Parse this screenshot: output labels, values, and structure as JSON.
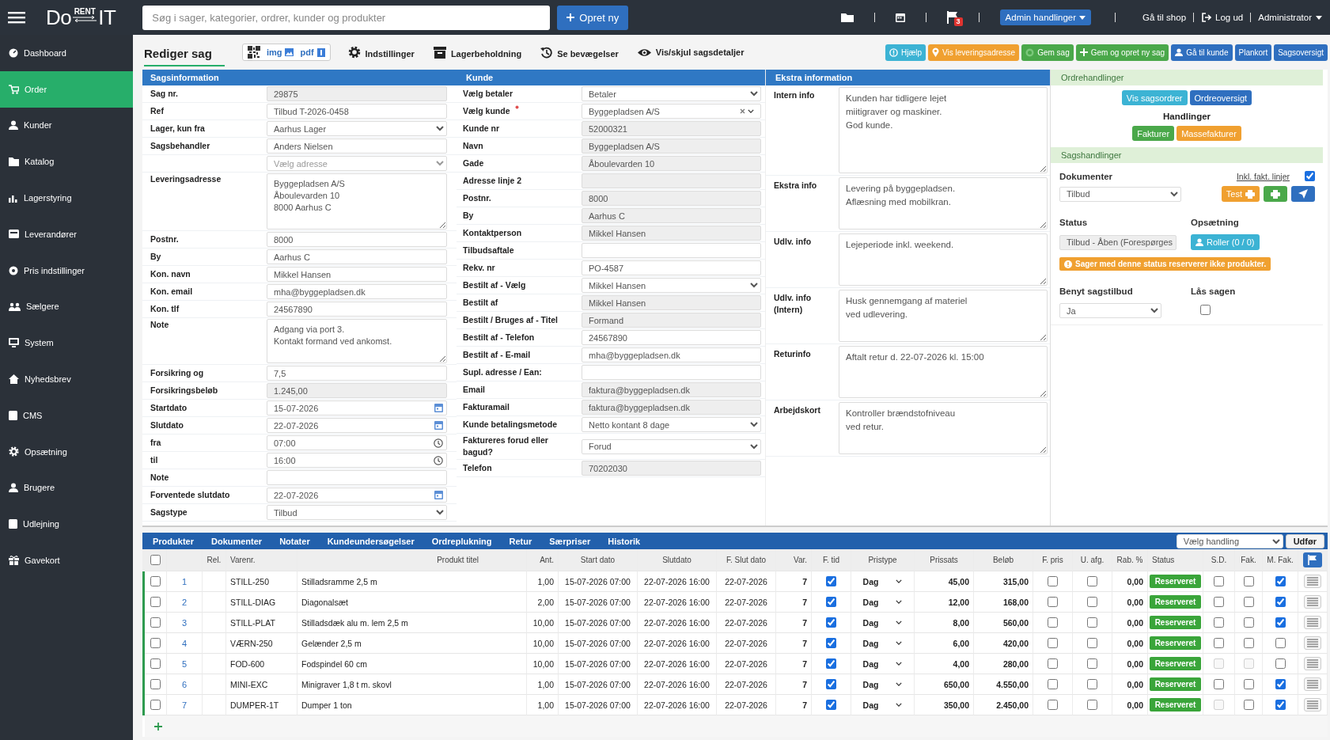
{
  "topbar": {
    "logo": {
      "left": "Do",
      "middle": "RENT",
      "right": "IT"
    },
    "search": {
      "placeholder": "Søg i sager, kategorier, ordrer, kunder og produkter"
    },
    "create_button": "Opret ny",
    "notification_count": "3",
    "admin_menu": "Admin handlinger",
    "shop_link": "Gå til shop",
    "logout_link": "Log ud",
    "user_menu": "Administrator"
  },
  "sidebar": {
    "items": [
      {
        "label": "Dashboard",
        "selected": false
      },
      {
        "label": "Order",
        "selected": true
      },
      {
        "label": "Kunder",
        "selected": false
      },
      {
        "label": "Katalog",
        "selected": false
      },
      {
        "label": "Lagerstyring",
        "selected": false
      },
      {
        "label": "Leverandører",
        "selected": false
      },
      {
        "label": "Pris indstillinger",
        "selected": false
      },
      {
        "label": "Sælgere",
        "selected": false
      },
      {
        "label": "System",
        "selected": false
      },
      {
        "label": "Nyhedsbrev",
        "selected": false
      },
      {
        "label": "CMS",
        "selected": false
      },
      {
        "label": "Opsætning",
        "selected": false
      },
      {
        "label": "Brugere",
        "selected": false
      },
      {
        "label": "Udlejning",
        "selected": false
      },
      {
        "label": "Gavekort",
        "selected": false
      }
    ]
  },
  "toolbar": {
    "title": "Rediger sag",
    "export_links": [
      "img",
      "pdf"
    ],
    "actions": [
      "Indstillinger",
      "Lagerbeholdning",
      "Se bevægelser",
      "Vis/skjul sagsdetaljer"
    ],
    "buttons": [
      {
        "label": "Hjælp",
        "kind": "info"
      },
      {
        "label": "Vis leveringsadresse",
        "kind": "warning"
      },
      {
        "label": "Gem sag",
        "kind": "success"
      },
      {
        "label": "Gem og opret ny sag",
        "kind": "success"
      },
      {
        "label": "Gå til kunde",
        "kind": "primary"
      },
      {
        "label": "Plankort",
        "kind": "primary"
      },
      {
        "label": "Sagsoversigt",
        "kind": "primary"
      }
    ]
  },
  "case_info": {
    "title": "Sagsinformation",
    "fields": [
      {
        "label": "Sag nr.",
        "value": "29875",
        "kind": "readonly"
      },
      {
        "label": "Ref",
        "value": "Tilbud T-2026-0458",
        "kind": "text"
      },
      {
        "label": "Lager, kun fra",
        "value": "Aarhus Lager",
        "kind": "select"
      },
      {
        "label": "Sagsbehandler",
        "value": "Anders Nielsen",
        "kind": "text"
      },
      {
        "placeholder": "Vælg adresse",
        "kind": "select"
      },
      {
        "label": "Leveringsadresse",
        "value": "Byggepladsen A/S\nÅboulevarden 10\n8000 Aarhus C",
        "kind": "textarea"
      },
      {
        "label": "Postnr.",
        "value": "8000",
        "kind": "text"
      },
      {
        "label": "By",
        "value": "Aarhus C",
        "kind": "text"
      },
      {
        "label": "Kon. navn",
        "value": "Mikkel Hansen",
        "kind": "text"
      },
      {
        "label": "Kon. email",
        "value": "mha@byggepladsen.dk",
        "kind": "text"
      },
      {
        "label": "Kon. tlf",
        "value": "24567890",
        "kind": "text"
      },
      {
        "label": "Note",
        "value": "Adgang via port 3.\nKontakt formand ved ankomst.",
        "kind": "textarea"
      },
      {
        "label": "Forsikring og",
        "value": "7,5",
        "kind": "text"
      },
      {
        "label": "Forsikringsbeløb",
        "value": "1.245,00",
        "kind": "readonly"
      },
      {
        "label": "Startdato",
        "value": "15-07-2026",
        "kind": "date"
      },
      {
        "label": "Slutdato",
        "value": "22-07-2026",
        "kind": "date"
      },
      {
        "label": "fra",
        "value": "07:00",
        "kind": "time"
      },
      {
        "label": "til",
        "value": "16:00",
        "kind": "time"
      },
      {
        "label": "Note",
        "kind": "text"
      },
      {
        "label": "Forventede slutdato",
        "value": "22-07-2026",
        "kind": "date"
      },
      {
        "label": "Sagstype",
        "value": "Tilbud",
        "kind": "select"
      }
    ]
  },
  "customer": {
    "title": "Kunde",
    "fields": [
      {
        "label": "Vælg betaler",
        "value": "Betaler",
        "kind": "select"
      },
      {
        "label": "Vælg kunde",
        "value": "Byggepladsen A/S",
        "kind": "combo",
        "required": true
      },
      {
        "label": "Kunde nr",
        "value": "52000321",
        "kind": "readonly"
      },
      {
        "label": "Navn",
        "value": "Byggepladsen A/S",
        "kind": "readonly"
      },
      {
        "label": "Gade",
        "value": "Åboulevarden 10",
        "kind": "readonly"
      },
      {
        "label": "Adresse linje 2",
        "kind": "readonly"
      },
      {
        "label": "Postnr.",
        "value": "8000",
        "kind": "readonly"
      },
      {
        "label": "By",
        "value": "Aarhus C",
        "kind": "readonly"
      },
      {
        "label": "Kontaktperson",
        "value": "Mikkel Hansen",
        "kind": "readonly"
      },
      {
        "label": "Tilbudsaftale",
        "kind": "text"
      },
      {
        "label": "Rekv. nr",
        "value": "PO-4587",
        "kind": "text"
      },
      {
        "label": "Bestilt af - Vælg",
        "value": "Mikkel Hansen",
        "kind": "select"
      },
      {
        "label": "Bestilt af",
        "value": "Mikkel Hansen",
        "kind": "readonly"
      },
      {
        "label": "Bestilt / Bruges af - Titel",
        "value": "Formand",
        "kind": "readonly"
      },
      {
        "label": "Bestilt af - Telefon",
        "value": "24567890",
        "kind": "text"
      },
      {
        "label": "Bestilt af - E-mail",
        "value": "mha@byggepladsen.dk",
        "kind": "text"
      },
      {
        "label": "Supl. adresse / Ean:",
        "kind": "text"
      },
      {
        "label": "Email",
        "value": "faktura@byggepladsen.dk",
        "kind": "readonly"
      },
      {
        "label": "Fakturamail",
        "value": "faktura@byggepladsen.dk",
        "kind": "readonly"
      },
      {
        "label": "Kunde betalingsmetode",
        "value": "Netto kontant 8 dage",
        "kind": "select"
      },
      {
        "label": "Faktureres forud eller bagud?",
        "value": "Forud",
        "kind": "select"
      },
      {
        "label": "Telefon",
        "value": "70202030",
        "kind": "readonly"
      }
    ]
  },
  "extra_info": {
    "title": "Ekstra information",
    "fields": [
      {
        "label": "Intern info",
        "value": "Kunden har tidligere lejet\nmiitigraver og maskiner.\nGod kunde."
      },
      {
        "label": "Ekstra info",
        "value": "Levering på byggepladsen.\nAflæsning med mobilkran."
      },
      {
        "label": "Udlv. info",
        "value": "Lejeperiode inkl. weekend."
      },
      {
        "label": "Udlv. info (Intern)",
        "value": "Husk gennemgang af materiel\nved udlevering."
      },
      {
        "label": "Returinfo",
        "value": "Aftalt retur d. 22-07-2026 kl. 15:00"
      },
      {
        "label": "Arbejdskort",
        "value": "Kontroller brændstofniveau\nved retur."
      }
    ]
  },
  "order_actions": {
    "title": "Ordrehandlinger",
    "buttons": [
      {
        "label": "Vis sagsordrer",
        "kind": "info"
      },
      {
        "label": "Ordreoversigt",
        "kind": "primary"
      }
    ],
    "subtitle": "Handlinger",
    "action_buttons": [
      {
        "label": "Fakturer",
        "kind": "success"
      },
      {
        "label": "Massefakturer",
        "kind": "warning"
      }
    ]
  },
  "case_actions": {
    "title": "Sagshandlinger",
    "documents_label": "Dokumenter",
    "include_lines_link": "Inkl. fakt. linjer",
    "include_lines": true,
    "document": "Tilbud",
    "test_button": "Test",
    "status_label": "Status",
    "status": "Tilbud - Åben (Forespørges",
    "setup_label": "Opsætning",
    "roles_button": "Roller (0 / 0)",
    "warning": "Sager med denne status reserverer ikke produkter.",
    "offer_label": "Benyt sagstilbud",
    "offer": "Ja",
    "lock_label": "Lås sagen",
    "locked": false
  },
  "products": {
    "tabs": [
      "Produkter",
      "Dokumenter",
      "Notater",
      "Kundeundersøgelser",
      "Ordreplukning",
      "Retur",
      "Særpriser",
      "Historik"
    ],
    "action_select": "Vælg handling",
    "run_button": "Udfør",
    "all_selected": false,
    "columns": [
      "Rel.",
      "Varenr.",
      "Produkt titel",
      "Ant.",
      "Start dato",
      "Slutdato",
      "F. Slut dato",
      "Var.",
      "F. tid",
      "Pristype",
      "Prissats",
      "Beløb",
      "F. pris",
      "U. afg.",
      "Rab. %",
      "Status",
      "S.D.",
      "Fak.",
      "M. Fak."
    ],
    "rows": [
      {
        "selected": false,
        "no": "1",
        "sku": "STILL-250",
        "title": "Stilladsramme 2,5 m",
        "qty": "1,00",
        "start": "15-07-2026 07:00",
        "end": "22-07-2026 16:00",
        "final_end": "22-07-2026",
        "var": "7",
        "fixed_time": true,
        "price_type": "Dag",
        "rate": "45,00",
        "amount": "315,00",
        "fixed_price": false,
        "no_fee": false,
        "discount": "0,00",
        "status": "Reserveret",
        "sd": {
          "checked": false,
          "disabled": false
        },
        "fak": {
          "checked": false,
          "disabled": false
        },
        "mfak": {
          "checked": true,
          "disabled": false
        }
      },
      {
        "selected": false,
        "no": "2",
        "sku": "STILL-DIAG",
        "title": "Diagonalsæt",
        "qty": "2,00",
        "start": "15-07-2026 07:00",
        "end": "22-07-2026 16:00",
        "final_end": "22-07-2026",
        "var": "7",
        "fixed_time": true,
        "price_type": "Dag",
        "rate": "12,00",
        "amount": "168,00",
        "fixed_price": false,
        "no_fee": false,
        "discount": "0,00",
        "status": "Reserveret",
        "sd": {
          "checked": false,
          "disabled": false
        },
        "fak": {
          "checked": false,
          "disabled": false
        },
        "mfak": {
          "checked": true,
          "disabled": false
        }
      },
      {
        "selected": false,
        "no": "3",
        "sku": "STILL-PLAT",
        "title": "Stilladsdæk alu m. lem 2,5 m",
        "qty": "10,00",
        "start": "15-07-2026 07:00",
        "end": "22-07-2026 16:00",
        "final_end": "22-07-2026",
        "var": "7",
        "fixed_time": true,
        "price_type": "Dag",
        "rate": "8,00",
        "amount": "560,00",
        "fixed_price": false,
        "no_fee": false,
        "discount": "0,00",
        "status": "Reserveret",
        "sd": {
          "checked": false,
          "disabled": false
        },
        "fak": {
          "checked": false,
          "disabled": false
        },
        "mfak": {
          "checked": true,
          "disabled": false
        }
      },
      {
        "selected": false,
        "no": "4",
        "sku": "VÆRN-250",
        "title": "Gelænder 2,5 m",
        "qty": "10,00",
        "start": "15-07-2026 07:00",
        "end": "22-07-2026 16:00",
        "final_end": "22-07-2026",
        "var": "7",
        "fixed_time": true,
        "price_type": "Dag",
        "rate": "6,00",
        "amount": "420,00",
        "fixed_price": false,
        "no_fee": false,
        "discount": "0,00",
        "status": "Reserveret",
        "sd": {
          "checked": false,
          "disabled": false
        },
        "fak": {
          "checked": false,
          "disabled": false
        },
        "mfak": {
          "checked": false,
          "disabled": false
        }
      },
      {
        "selected": false,
        "no": "5",
        "sku": "FOD-600",
        "title": "Fodspindel 60 cm",
        "qty": "10,00",
        "start": "15-07-2026 07:00",
        "end": "22-07-2026 16:00",
        "final_end": "22-07-2026",
        "var": "7",
        "fixed_time": true,
        "price_type": "Dag",
        "rate": "4,00",
        "amount": "280,00",
        "fixed_price": false,
        "no_fee": false,
        "discount": "0,00",
        "status": "Reserveret",
        "sd": {
          "checked": false,
          "disabled": true
        },
        "fak": {
          "checked": false,
          "disabled": true
        },
        "mfak": {
          "checked": false,
          "disabled": false
        }
      },
      {
        "selected": false,
        "no": "6",
        "sku": "MINI-EXC",
        "title": "Minigraver 1,8 t m. skovl",
        "qty": "1,00",
        "start": "15-07-2026 07:00",
        "end": "22-07-2026 16:00",
        "final_end": "22-07-2026",
        "var": "7",
        "fixed_time": true,
        "price_type": "Dag",
        "rate": "650,00",
        "amount": "4.550,00",
        "fixed_price": false,
        "no_fee": false,
        "discount": "0,00",
        "status": "Reserveret",
        "sd": {
          "checked": false,
          "disabled": false
        },
        "fak": {
          "checked": false,
          "disabled": false
        },
        "mfak": {
          "checked": true,
          "disabled": false
        }
      },
      {
        "selected": false,
        "no": "7",
        "sku": "DUMPER-1T",
        "title": "Dumper 1 ton",
        "qty": "1,00",
        "start": "15-07-2026 07:00",
        "end": "22-07-2026 16:00",
        "final_end": "22-07-2026",
        "var": "7",
        "fixed_time": true,
        "price_type": "Dag",
        "rate": "350,00",
        "amount": "2.450,00",
        "fixed_price": false,
        "no_fee": false,
        "discount": "0,00",
        "status": "Reserveret",
        "sd": {
          "checked": false,
          "disabled": true
        },
        "fak": {
          "checked": false,
          "disabled": false
        },
        "mfak": {
          "checked": true,
          "disabled": false
        }
      }
    ]
  }
}
